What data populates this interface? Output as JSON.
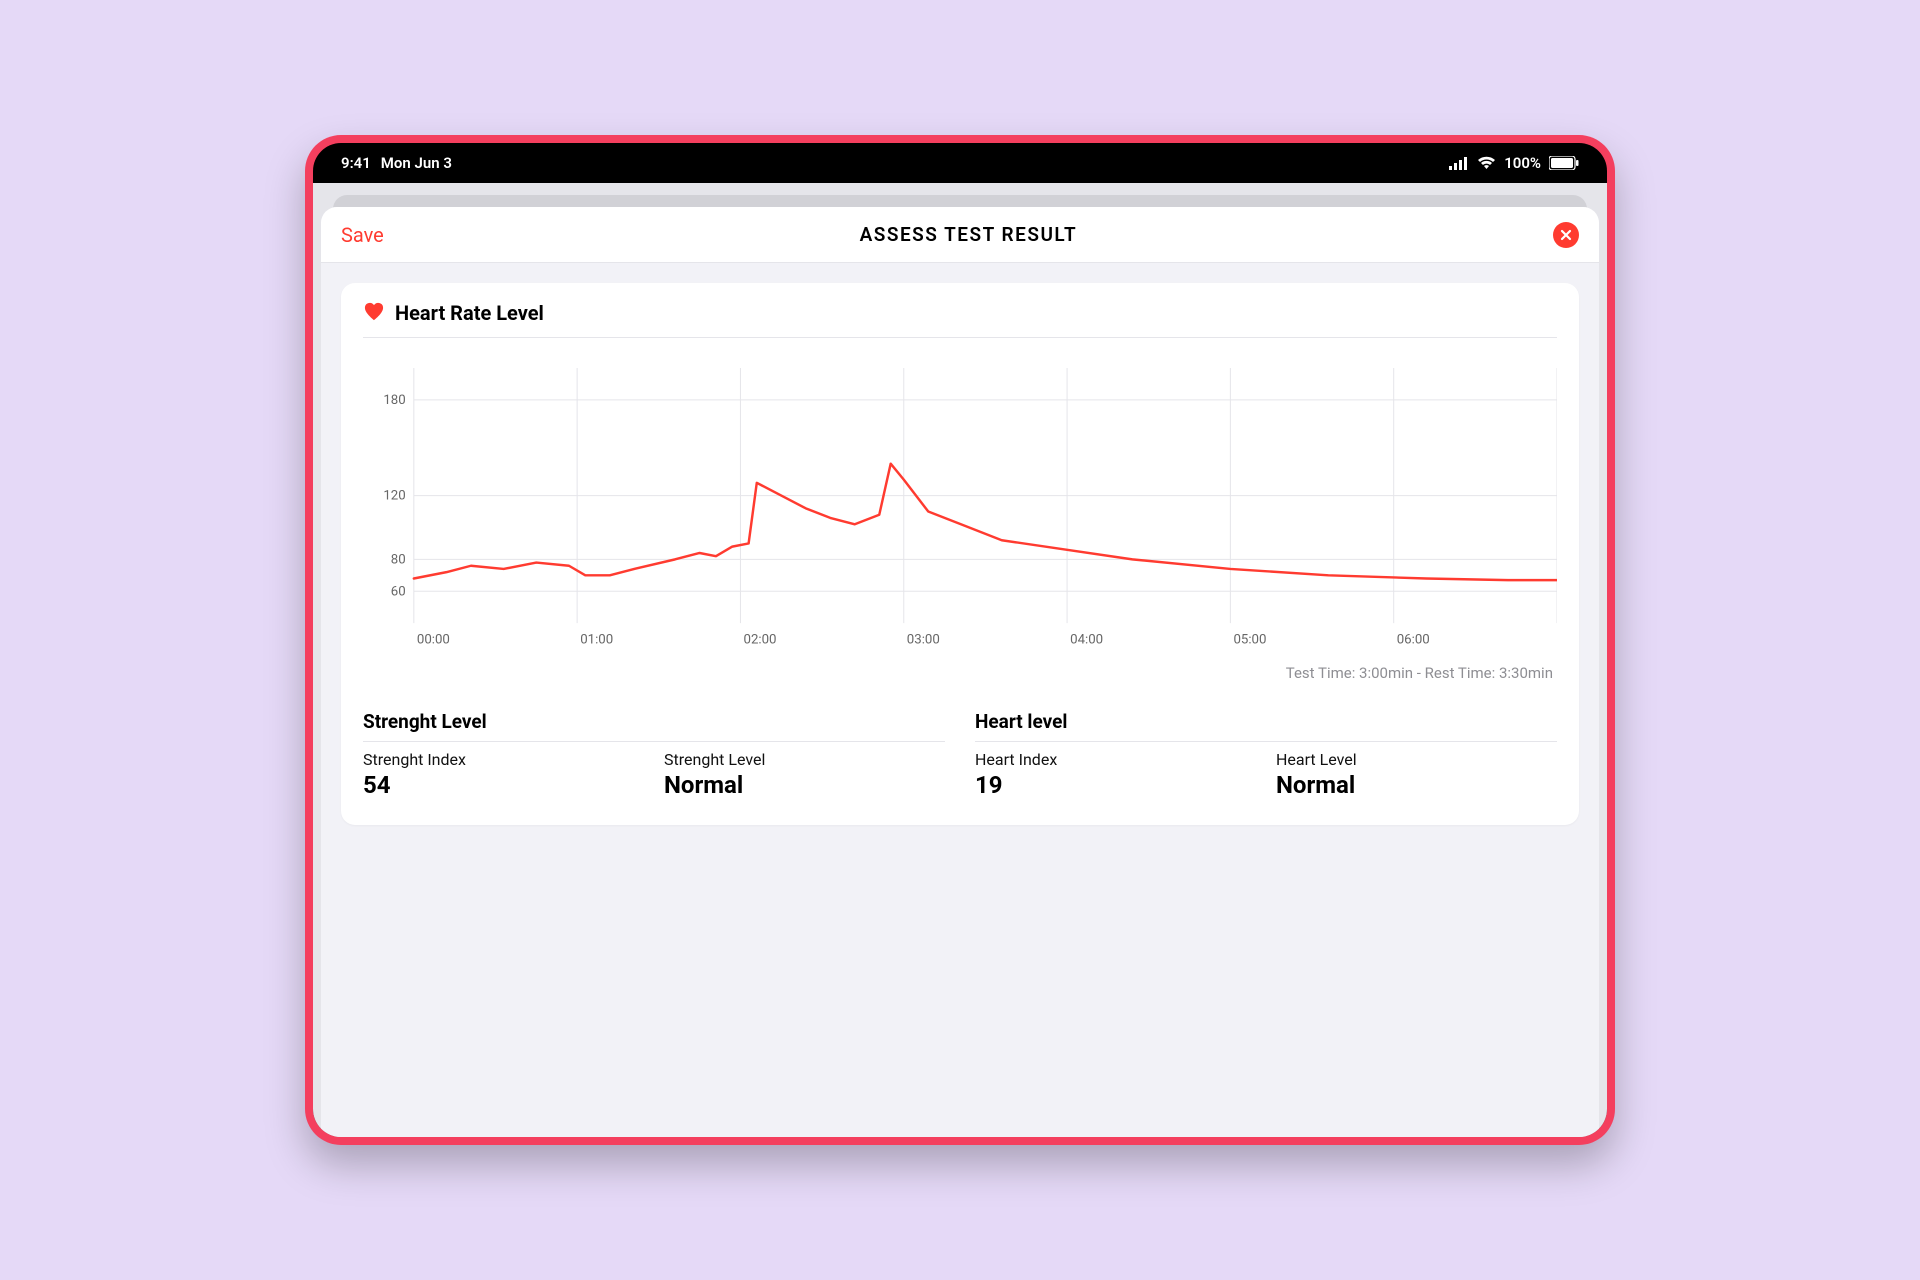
{
  "status_bar": {
    "time": "9:41",
    "date": "Mon Jun 3",
    "battery": "100%"
  },
  "header": {
    "save_label": "Save",
    "title": "ASSESS TEST RESULT"
  },
  "card": {
    "title": "Heart Rate Level",
    "time_note": "Test Time: 3:00min - Rest Time: 3:30min"
  },
  "metrics": {
    "strength": {
      "title": "Strenght Level",
      "index_label": "Strenght Index",
      "index_value": "54",
      "level_label": "Strenght Level",
      "level_value": "Normal"
    },
    "heart": {
      "title": "Heart level",
      "index_label": "Heart Index",
      "index_value": "19",
      "level_label": "Heart Level",
      "level_value": "Normal"
    }
  },
  "chart_data": {
    "type": "line",
    "title": "Heart Rate Level",
    "xlabel": "",
    "ylabel": "",
    "y_ticks": [
      60,
      80,
      120,
      180
    ],
    "ylim": [
      40,
      200
    ],
    "x_ticks": [
      "00:00",
      "01:00",
      "02:00",
      "03:00",
      "04:00",
      "05:00",
      "06:00"
    ],
    "xlim": [
      0,
      7
    ],
    "series": [
      {
        "name": "Heart Rate",
        "x": [
          0.0,
          0.2,
          0.35,
          0.55,
          0.75,
          0.95,
          1.05,
          1.2,
          1.35,
          1.6,
          1.75,
          1.85,
          1.95,
          2.05,
          2.1,
          2.25,
          2.4,
          2.55,
          2.7,
          2.85,
          2.92,
          3.0,
          3.15,
          3.35,
          3.6,
          4.0,
          4.4,
          5.0,
          5.6,
          6.2,
          6.7,
          7.0
        ],
        "y": [
          68,
          72,
          76,
          74,
          78,
          76,
          70,
          70,
          74,
          80,
          84,
          82,
          88,
          90,
          128,
          120,
          112,
          106,
          102,
          108,
          140,
          130,
          110,
          102,
          92,
          86,
          80,
          74,
          70,
          68,
          67,
          67
        ]
      }
    ]
  }
}
